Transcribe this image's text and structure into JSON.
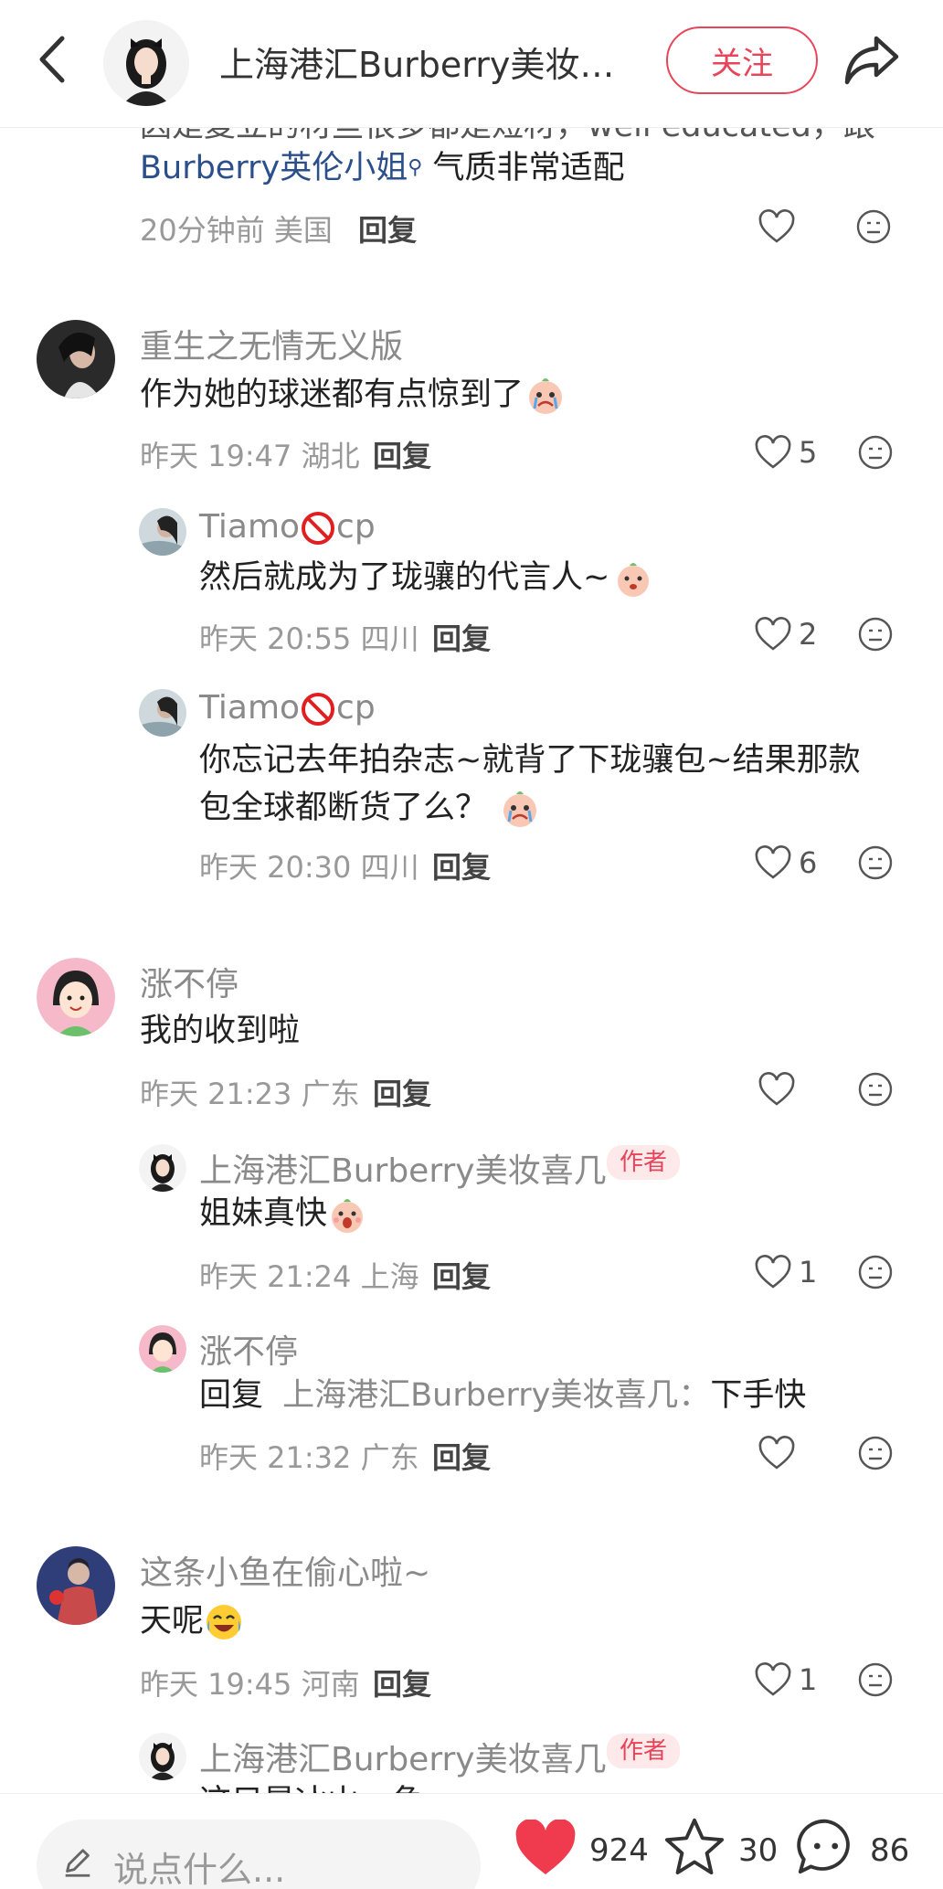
{
  "header": {
    "title": "上海港汇Burberry美妆…",
    "follow_label": "关注"
  },
  "top_partial": {
    "line1": "因是复立的材些很多都是短材，well educated，跟",
    "line2_link": "Burberry英伦小姐",
    "line2_rest": "气质非常适配",
    "meta": "20分钟前 美国",
    "reply_label": "回复"
  },
  "comments": [
    {
      "user": "重生之无情无义版",
      "text": "作为她的球迷都有点惊到了",
      "meta": "昨天 19:47 湖北",
      "reply_label": "回复",
      "likes": "5"
    },
    {
      "user": "Tiamo",
      "user_suffix": "cp",
      "text": "然后就成为了珑骧的代言人~",
      "meta": "昨天 20:55 四川",
      "reply_label": "回复",
      "likes": "2"
    },
    {
      "user": "Tiamo",
      "user_suffix": "cp",
      "text_line1": "你忘记去年拍杂志~就背了下珑骧包~结果那款",
      "text_line2": "包全球都断货了么？",
      "meta": "昨天 20:30 四川",
      "reply_label": "回复",
      "likes": "6"
    },
    {
      "user": "涨不停",
      "text": "我的收到啦",
      "meta": "昨天 21:23 广东",
      "reply_label": "回复",
      "likes": ""
    },
    {
      "user": "上海港汇Burberry美妆喜几",
      "badge": "作者",
      "text": "姐妹真快",
      "meta": "昨天 21:24 上海",
      "reply_label": "回复",
      "likes": "1"
    },
    {
      "user": "涨不停",
      "reply_prefix": "回复",
      "reply_to": "上海港汇Burberry美妆喜几：",
      "text": "下手快",
      "meta": "昨天 21:32 广东",
      "reply_label": "回复",
      "likes": ""
    },
    {
      "user": "这条小鱼在偷心啦~",
      "text": "天呢",
      "meta": "昨天 19:45 河南",
      "reply_label": "回复",
      "likes": "1"
    },
    {
      "user": "上海港汇Burberry美妆喜几",
      "badge": "作者",
      "text": "这只是冰山一角",
      "meta": "",
      "reply_label": "",
      "likes": ""
    }
  ],
  "bottom": {
    "input_placeholder": "说点什么...",
    "likes": "924",
    "favorites": "30",
    "comments": "86"
  },
  "colors": {
    "accent": "#e8455a",
    "link": "#2b4f8a",
    "muted": "#999999"
  }
}
